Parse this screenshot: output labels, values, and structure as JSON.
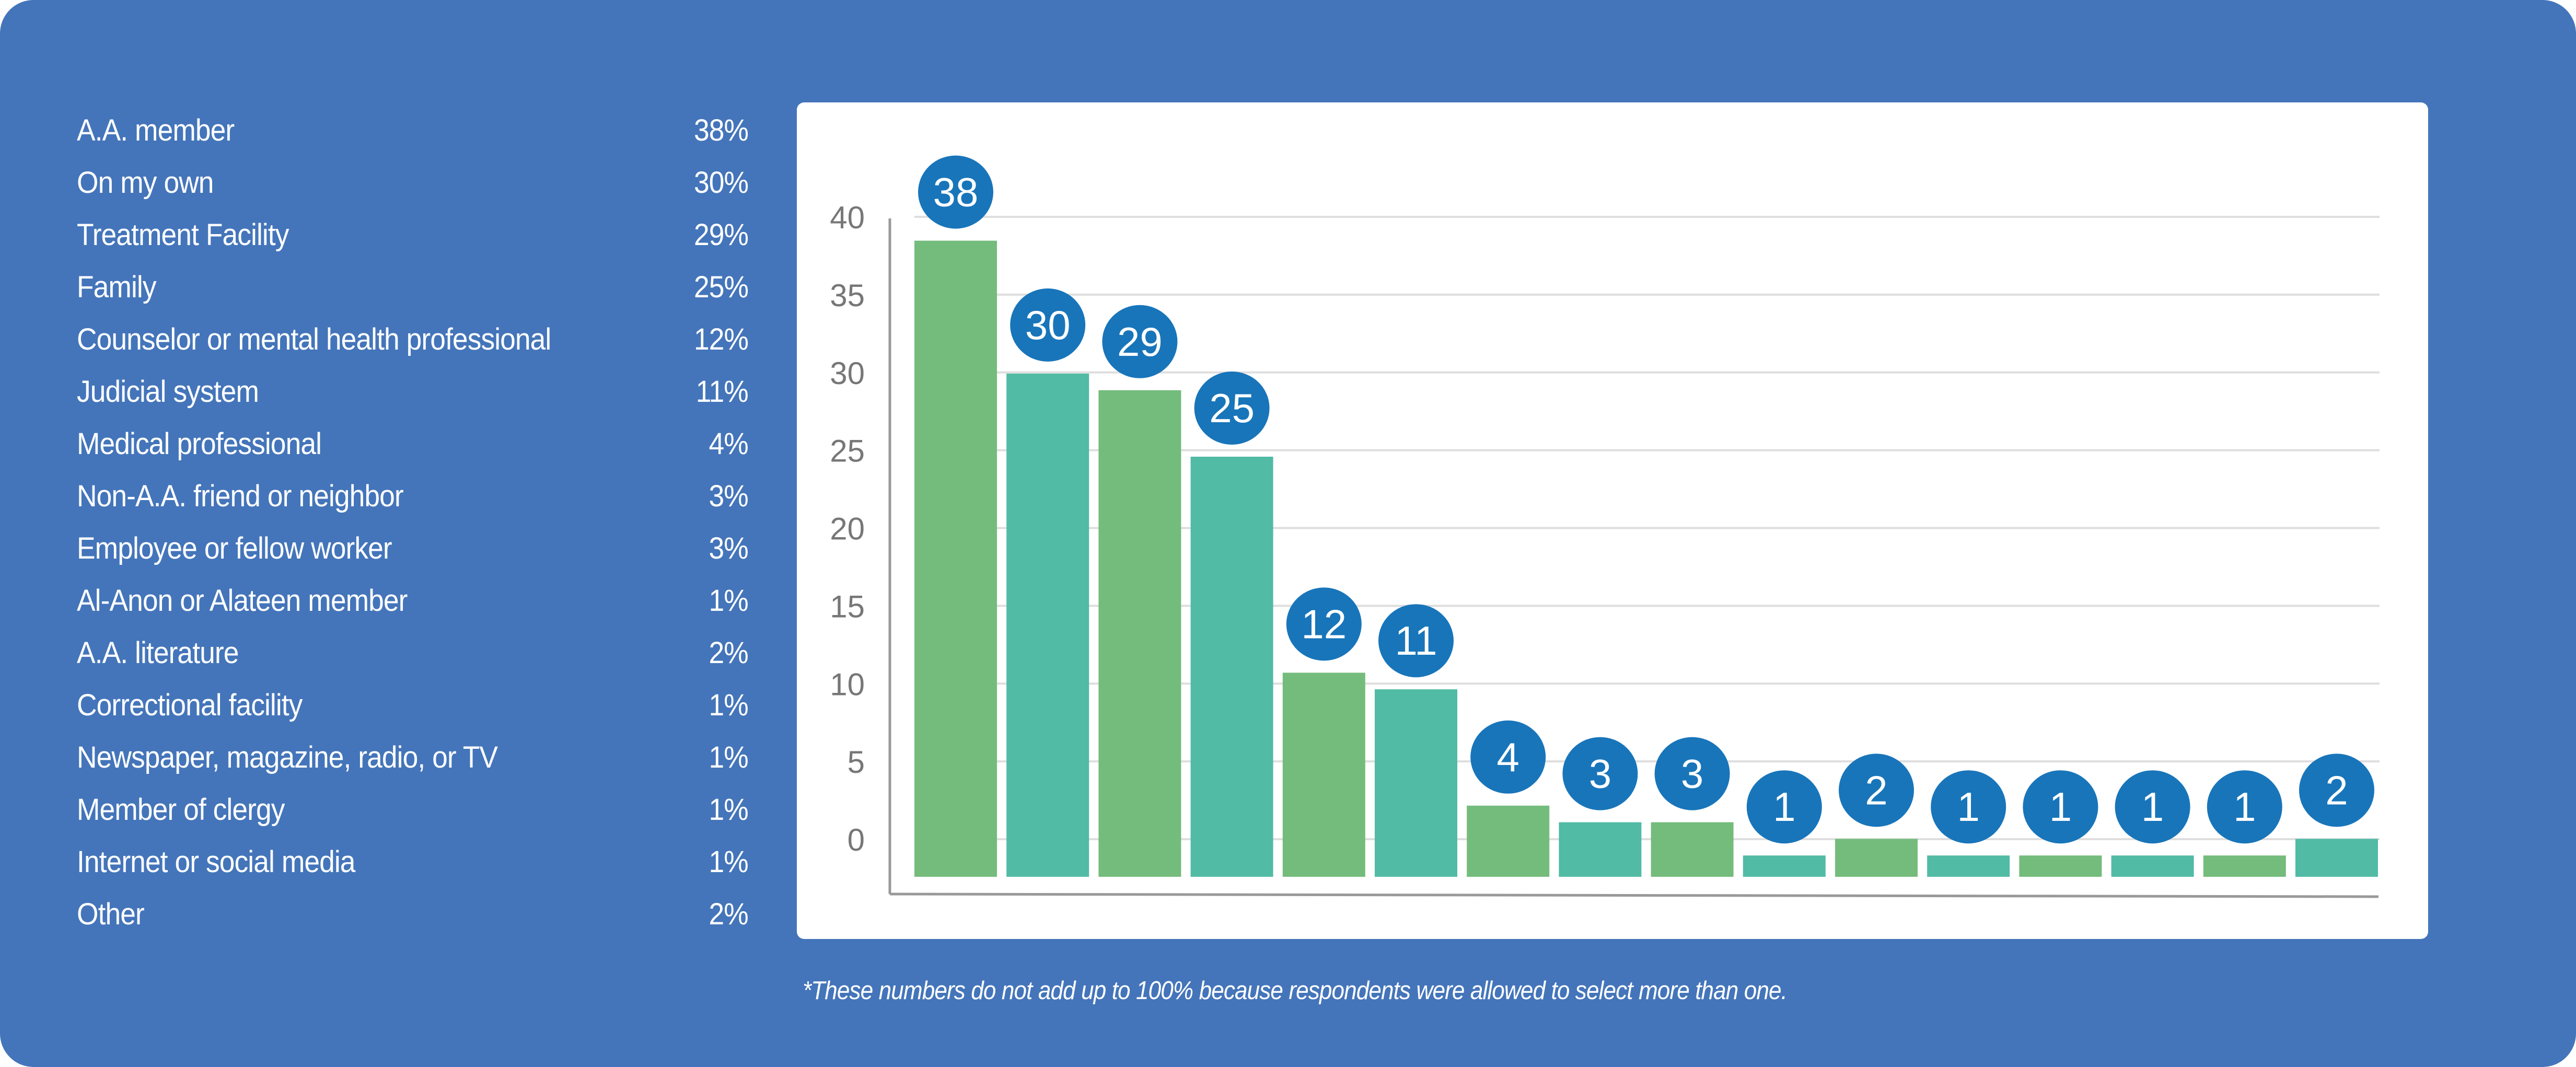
{
  "legend": [
    {
      "label": "A.A. member",
      "value": "38%"
    },
    {
      "label": "On my own",
      "value": "30%"
    },
    {
      "label": "Treatment Facility",
      "value": "29%"
    },
    {
      "label": "Family",
      "value": "25%"
    },
    {
      "label": "Counselor or mental health professional",
      "value": "12%"
    },
    {
      "label": "Judicial system",
      "value": "11%"
    },
    {
      "label": "Medical professional",
      "value": "4%"
    },
    {
      "label": "Non-A.A. friend or neighbor",
      "value": "3%"
    },
    {
      "label": "Employee or fellow worker",
      "value": "3%"
    },
    {
      "label": "Al-Anon or Alateen member",
      "value": "1%"
    },
    {
      "label": "A.A. literature",
      "value": "2%"
    },
    {
      "label": "Correctional facility",
      "value": "1%"
    },
    {
      "label": "Newspaper, magazine, radio, or TV",
      "value": "1%"
    },
    {
      "label": "Member of clergy",
      "value": "1%"
    },
    {
      "label": "Internet or social media",
      "value": "1%"
    },
    {
      "label": "Other",
      "value": "2%"
    }
  ],
  "footnote": "*These numbers do not add up to 100% because respondents were allowed to select more than one.",
  "colors": {
    "panel": "#4475BA",
    "bar_green": "#74BC7C",
    "bar_teal": "#51BBA5",
    "label_circle": "#1875BA",
    "gridline": "#DEDEDE",
    "axis": "#999999",
    "tick_text": "#777777"
  },
  "chart_data": {
    "type": "bar",
    "title": "",
    "xlabel": "",
    "ylabel": "",
    "categories": [
      "A.A. member",
      "On my own",
      "Treatment Facility",
      "Family",
      "Counselor or mental health professional",
      "Judicial system",
      "Medical professional",
      "Non-A.A. friend or neighbor",
      "Employee or fellow worker",
      "Al-Anon or Alateen member",
      "A.A. literature",
      "Correctional facility",
      "Newspaper, magazine, radio, or TV",
      "Member of clergy",
      "Internet or social media",
      "Other"
    ],
    "values": [
      38,
      30,
      29,
      25,
      12,
      11,
      4,
      3,
      3,
      1,
      2,
      1,
      1,
      1,
      1,
      2
    ],
    "data_labels": [
      "38",
      "30",
      "29",
      "25",
      "12",
      "11",
      "4",
      "3",
      "3",
      "1",
      "2",
      "1",
      "1",
      "1",
      "1",
      "2"
    ],
    "yticks": [
      0,
      5,
      10,
      15,
      20,
      25,
      30,
      35,
      40
    ],
    "ytick_labels": [
      "0",
      "5",
      "10",
      "15",
      "20",
      "25",
      "30",
      "35",
      "40"
    ],
    "ylim": [
      0,
      40
    ],
    "grid": true,
    "legend": "left",
    "bar_color_pattern": [
      "green",
      "teal"
    ]
  }
}
